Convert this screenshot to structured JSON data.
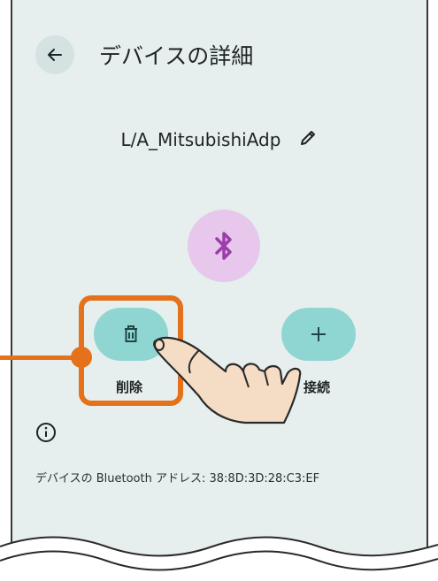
{
  "header": {
    "title": "デバイスの詳細",
    "back_icon": "arrow-left-icon"
  },
  "device": {
    "name": "L/A_MitsubishiAdp",
    "edit_icon": "pencil-icon",
    "type_icon": "bluetooth-icon"
  },
  "actions": [
    {
      "label": "削除",
      "icon": "trash-icon",
      "highlighted": true
    },
    {
      "label": "接続",
      "icon": "plus-icon",
      "highlighted": false
    }
  ],
  "info": {
    "icon": "info-icon",
    "address_text": "デバイスの Bluetooth アドレス: 38:8D:3D:28:C3:EF"
  },
  "colors": {
    "background": "#e6efee",
    "accent_button": "#8fd6d2",
    "bt_circle": "#e7c7ec",
    "highlight": "#e5711a",
    "hand": "#f5dcc4"
  }
}
